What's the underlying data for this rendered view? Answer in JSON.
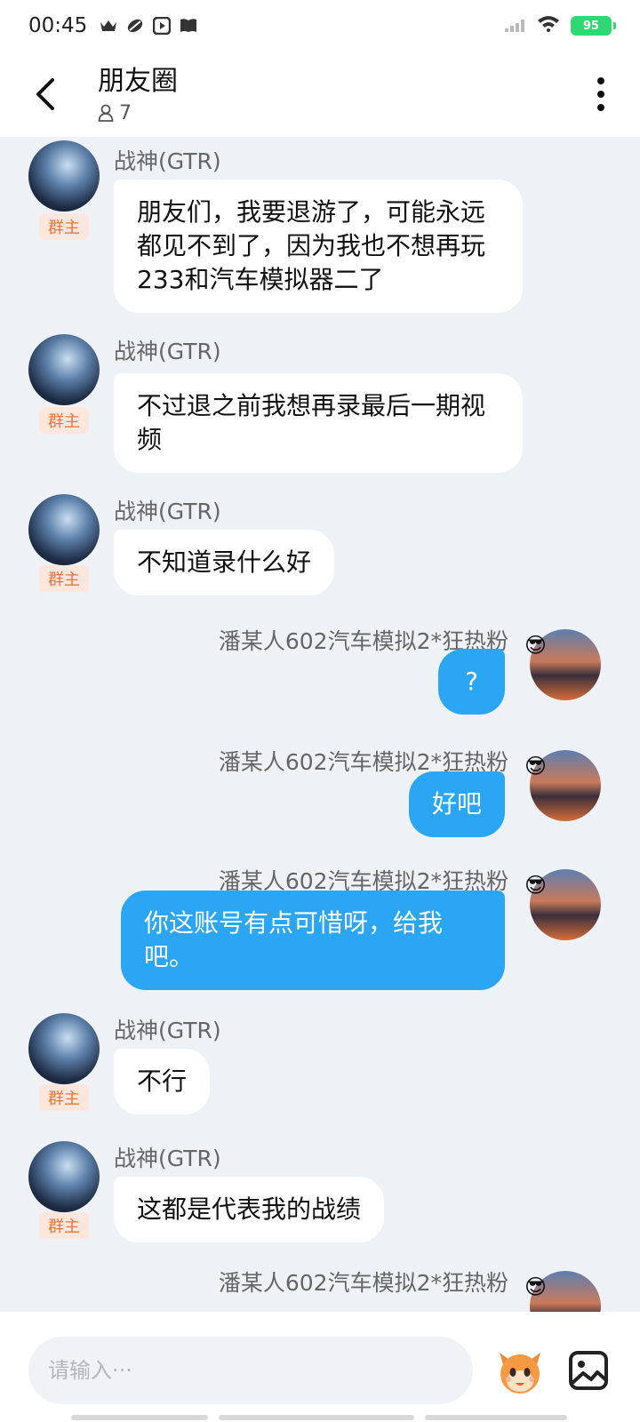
{
  "status_bar": {
    "time": "00:45",
    "battery": "95",
    "icons": [
      "crown-icon",
      "leaf-icon",
      "play-icon",
      "book-icon"
    ]
  },
  "header": {
    "title": "朋友圈",
    "member_count": "7"
  },
  "messages": [
    {
      "side": "left",
      "sender": "战神(GTR)",
      "badge": "群主",
      "text": "朋友们，我要退游了，可能永远都见不到了，因为我也不想再玩233和汽车模拟器二了"
    },
    {
      "side": "left",
      "sender": "战神(GTR)",
      "badge": "群主",
      "text": "不过退之前我想再录最后一期视频"
    },
    {
      "side": "left",
      "sender": "战神(GTR)",
      "badge": "群主",
      "text": "不知道录什么好"
    },
    {
      "side": "right",
      "sender": "潘某人602汽车模拟2*狂热粉",
      "text": "?"
    },
    {
      "side": "right",
      "sender": "潘某人602汽车模拟2*狂热粉",
      "text": "好吧"
    },
    {
      "side": "right",
      "sender": "潘某人602汽车模拟2*狂热粉",
      "text": "你这账号有点可惜呀，给我吧。"
    },
    {
      "side": "left",
      "sender": "战神(GTR)",
      "badge": "群主",
      "text": "不行"
    },
    {
      "side": "left",
      "sender": "战神(GTR)",
      "badge": "群主",
      "text": "这都是代表我的战绩"
    },
    {
      "side": "right",
      "sender": "潘某人602汽车模拟2*狂热粉",
      "text": ""
    }
  ],
  "input": {
    "placeholder": "请输入···"
  },
  "colors": {
    "accent_blue": "#2aa6f4",
    "badge_bg": "#fde6dc",
    "badge_text": "#e7773f",
    "battery": "#2fd872"
  }
}
